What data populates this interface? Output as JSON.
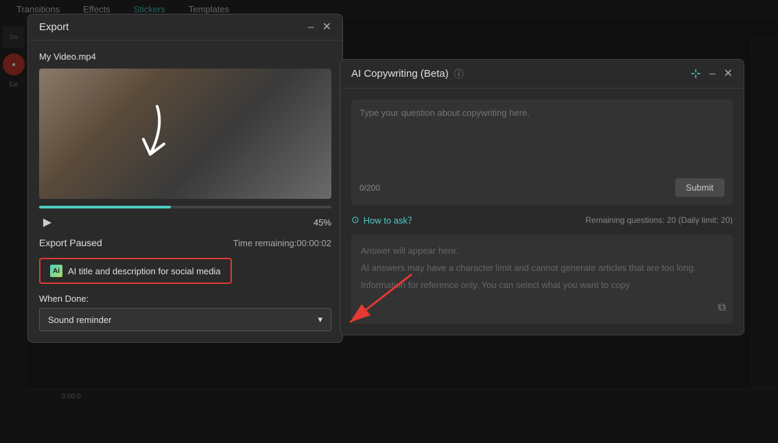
{
  "tabs": {
    "items": [
      "Transitions",
      "Effects",
      "Stickers",
      "Templates"
    ],
    "active": 2
  },
  "export_dialog": {
    "title": "Export",
    "filename": "My Video.mp4",
    "progress_percent": 45,
    "progress_display": "45%",
    "progress_bar_width": "45%",
    "status": "Export Paused",
    "time_remaining_label": "Time remaining:",
    "time_remaining_value": "00:00:02",
    "ai_button_label": "AI title and description for social media",
    "when_done_label": "When Done:",
    "dropdown_value": "Sound reminder",
    "minimize_label": "–",
    "close_label": "✕"
  },
  "ai_panel": {
    "title": "AI Copywriting (Beta)",
    "textarea_placeholder": "Type your question about copywriting here.",
    "char_count": "0/200",
    "submit_label": "Submit",
    "how_to_ask_label": "How to ask？",
    "remaining_questions": "Remaining questions: 20 (Daily limit: 20)",
    "answer_placeholder_line1": "Answer will appear here.",
    "answer_placeholder_line2": "AI answers may have a character limit and cannot generate articles that are too long.",
    "answer_placeholder_line3": "Information for reference only. You can select what you want to copy",
    "pin_label": "📌",
    "minimize_label": "–",
    "close_label": "✕"
  },
  "icons": {
    "play": "▶",
    "chevron_down": "▾",
    "info": "ⓘ",
    "question_circle": "?",
    "copy": "⧉",
    "pin": "⊕"
  }
}
